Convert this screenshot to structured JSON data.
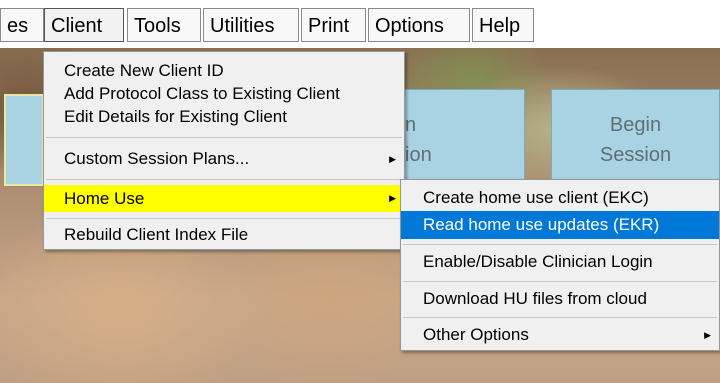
{
  "menubar": {
    "items": [
      "es",
      "Client",
      "Tools",
      "Utilities",
      "Print",
      "Options",
      "Help"
    ]
  },
  "tiles": {
    "tile2_line1": "n",
    "tile2_line2": "ion",
    "tile3_line1": "Begin",
    "tile3_line2": "Session"
  },
  "client_menu": {
    "items": [
      "Create New Client ID",
      "Add Protocol Class to Existing Client",
      "Edit Details for Existing Client",
      "Custom Session Plans...",
      "Home Use",
      "Rebuild Client Index File"
    ]
  },
  "home_use_menu": {
    "items": [
      "Create home use client (EKC)",
      "Read home use updates (EKR)",
      "Enable/Disable Clinician Login",
      "Download HU files from cloud",
      "Other Options"
    ]
  },
  "icons": {
    "submenu_arrow": "triangle-right-icon"
  },
  "colors": {
    "highlight_yellow": "#ffff00",
    "highlight_blue": "#0078d7",
    "tile_blue": "#a9d3e2"
  }
}
